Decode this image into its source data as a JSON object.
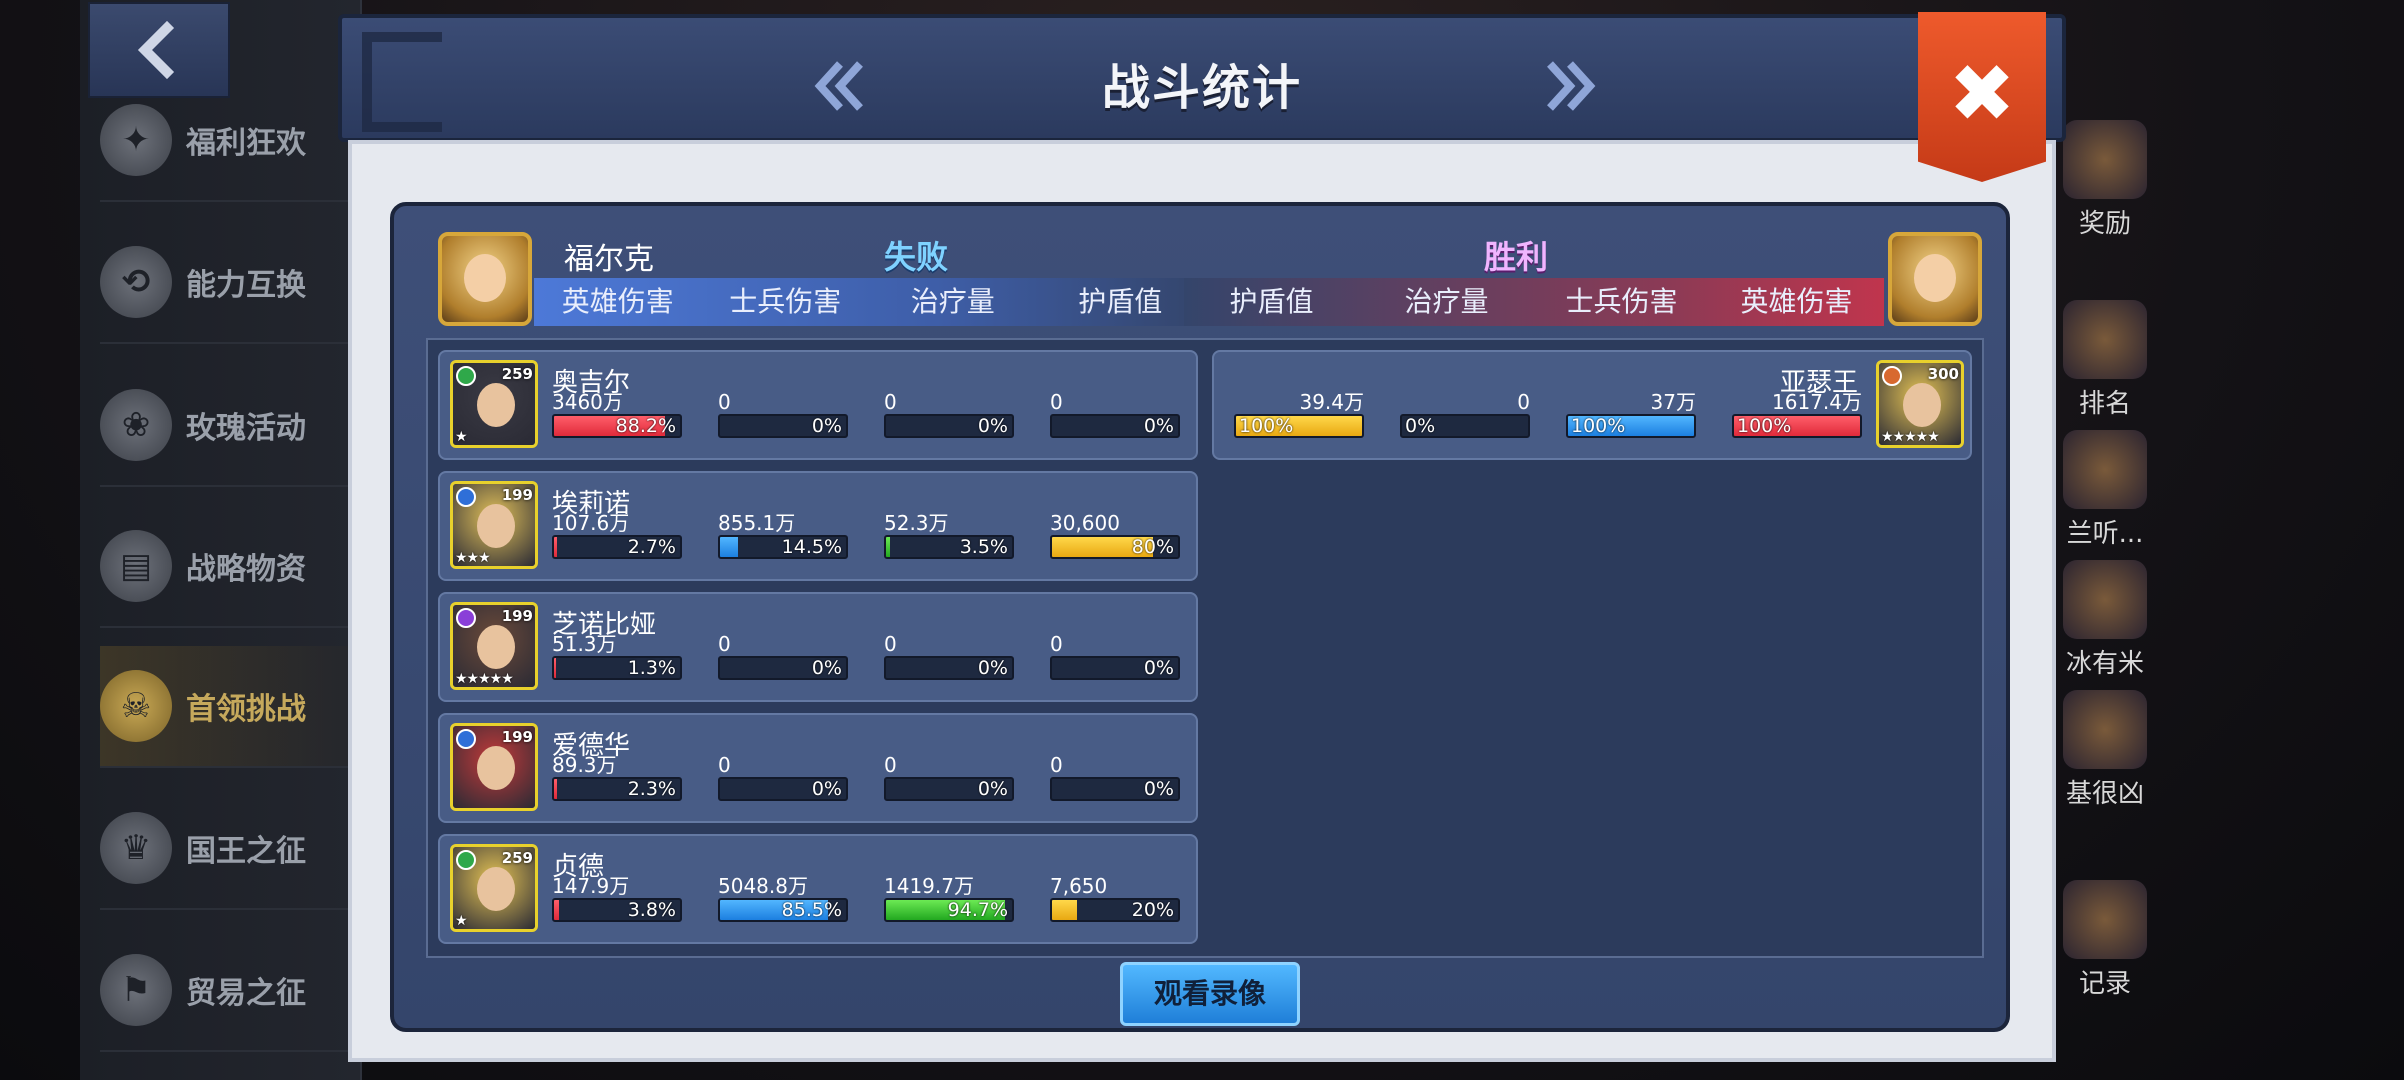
{
  "left_menu": {
    "items": [
      {
        "label": "福利狂欢",
        "icon": "party-icon"
      },
      {
        "label": "能力互换",
        "icon": "swap-icon"
      },
      {
        "label": "玫瑰活动",
        "icon": "rose-icon"
      },
      {
        "label": "战略物资",
        "icon": "supplies-icon"
      },
      {
        "label": "首领挑战",
        "icon": "boss-skull-icon"
      },
      {
        "label": "国王之征",
        "icon": "crown-icon"
      },
      {
        "label": "贸易之征",
        "icon": "trade-icon"
      }
    ]
  },
  "right_side": {
    "items": [
      "奖励",
      "排名",
      "兰听...",
      "冰有米",
      "基很凶",
      "记录"
    ]
  },
  "panel": {
    "title": "战斗统计",
    "close_label": "✖",
    "replay_label": "观看录像"
  },
  "left_team": {
    "player_name": "福尔克",
    "result": "失败",
    "columns": [
      "英雄伤害",
      "士兵伤害",
      "治疗量",
      "护盾值"
    ],
    "heroes": [
      {
        "name": "奥吉尔",
        "level": "259",
        "gem_color": "#2fa84a",
        "stars": "★",
        "stats": [
          {
            "value": "3460万",
            "percent": "88.2%",
            "fill": 88.2,
            "color": "red"
          },
          {
            "value": "0",
            "percent": "0%",
            "fill": 0,
            "color": "blue"
          },
          {
            "value": "0",
            "percent": "0%",
            "fill": 0,
            "color": "green"
          },
          {
            "value": "0",
            "percent": "0%",
            "fill": 0,
            "color": "yellow"
          }
        ]
      },
      {
        "name": "埃莉诺",
        "level": "199",
        "gem_color": "#2f6fd8",
        "stars": "★★★",
        "stats": [
          {
            "value": "107.6万",
            "percent": "2.7%",
            "fill": 2.7,
            "color": "red"
          },
          {
            "value": "855.1万",
            "percent": "14.5%",
            "fill": 14.5,
            "color": "blue"
          },
          {
            "value": "52.3万",
            "percent": "3.5%",
            "fill": 3.5,
            "color": "green"
          },
          {
            "value": "30,600",
            "percent": "80%",
            "fill": 80,
            "color": "yellow"
          }
        ]
      },
      {
        "name": "芝诺比娅",
        "level": "199",
        "gem_color": "#8a3fd8",
        "stars": "★★★★★",
        "stats": [
          {
            "value": "51.3万",
            "percent": "1.3%",
            "fill": 1.3,
            "color": "red"
          },
          {
            "value": "0",
            "percent": "0%",
            "fill": 0,
            "color": "blue"
          },
          {
            "value": "0",
            "percent": "0%",
            "fill": 0,
            "color": "green"
          },
          {
            "value": "0",
            "percent": "0%",
            "fill": 0,
            "color": "yellow"
          }
        ]
      },
      {
        "name": "爱德华",
        "level": "199",
        "gem_color": "#2f6fd8",
        "stars": "",
        "stats": [
          {
            "value": "89.3万",
            "percent": "2.3%",
            "fill": 2.3,
            "color": "red"
          },
          {
            "value": "0",
            "percent": "0%",
            "fill": 0,
            "color": "blue"
          },
          {
            "value": "0",
            "percent": "0%",
            "fill": 0,
            "color": "green"
          },
          {
            "value": "0",
            "percent": "0%",
            "fill": 0,
            "color": "yellow"
          }
        ]
      },
      {
        "name": "贞德",
        "level": "259",
        "gem_color": "#2fa84a",
        "stars": "★",
        "stats": [
          {
            "value": "147.9万",
            "percent": "3.8%",
            "fill": 3.8,
            "color": "red"
          },
          {
            "value": "5048.8万",
            "percent": "85.5%",
            "fill": 85.5,
            "color": "blue"
          },
          {
            "value": "1419.7万",
            "percent": "94.7%",
            "fill": 94.7,
            "color": "green"
          },
          {
            "value": "7,650",
            "percent": "20%",
            "fill": 20,
            "color": "yellow"
          }
        ]
      }
    ]
  },
  "right_team": {
    "result": "胜利",
    "columns": [
      "护盾值",
      "治疗量",
      "士兵伤害",
      "英雄伤害"
    ],
    "heroes": [
      {
        "name": "亚瑟王",
        "level": "300",
        "gem_color": "#d8692f",
        "stars": "★★★★★",
        "stats": [
          {
            "value": "39.4万",
            "percent": "100%",
            "fill": 100,
            "color": "yellow"
          },
          {
            "value": "0",
            "percent": "0%",
            "fill": 0,
            "color": "green"
          },
          {
            "value": "37万",
            "percent": "100%",
            "fill": 100,
            "color": "blue"
          },
          {
            "value": "1617.4万",
            "percent": "100%",
            "fill": 100,
            "color": "red"
          }
        ]
      }
    ]
  }
}
